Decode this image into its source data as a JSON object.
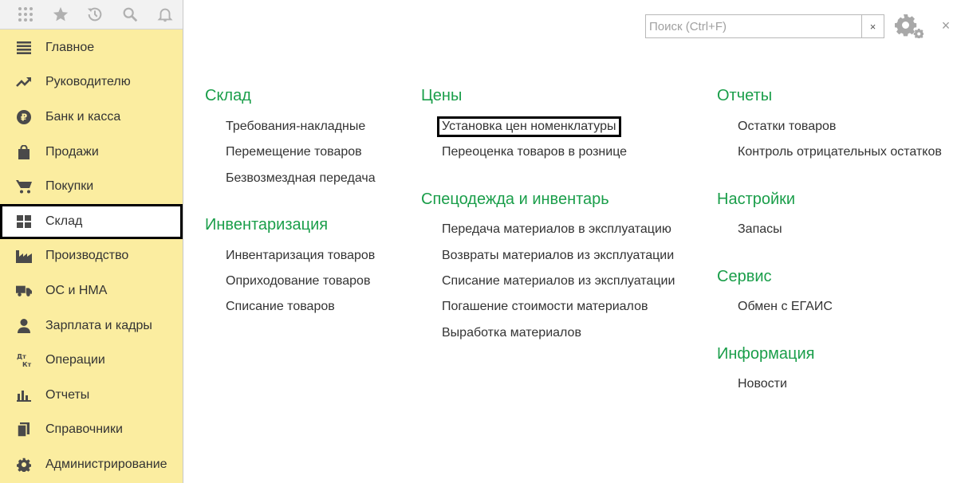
{
  "topbar": {
    "icons": [
      "apps-grid-icon",
      "star-icon",
      "history-icon",
      "search-icon",
      "bell-icon"
    ]
  },
  "sidebar": {
    "items": [
      {
        "label": "Главное",
        "icon": "menu-lines-icon"
      },
      {
        "label": "Руководителю",
        "icon": "trend-up-icon"
      },
      {
        "label": "Банк и касса",
        "icon": "ruble-coin-icon"
      },
      {
        "label": "Продажи",
        "icon": "shopping-bag-icon"
      },
      {
        "label": "Покупки",
        "icon": "cart-icon"
      },
      {
        "label": "Склад",
        "icon": "warehouse-grid-icon",
        "active": true
      },
      {
        "label": "Производство",
        "icon": "factory-icon"
      },
      {
        "label": "ОС и НМА",
        "icon": "truck-icon"
      },
      {
        "label": "Зарплата и кадры",
        "icon": "person-icon"
      },
      {
        "label": "Операции",
        "icon": "debit-credit-icon",
        "icon_text": "Дт Кт"
      },
      {
        "label": "Отчеты",
        "icon": "bar-chart-icon"
      },
      {
        "label": "Справочники",
        "icon": "books-icon"
      },
      {
        "label": "Администрирование",
        "icon": "gear-icon"
      }
    ]
  },
  "search": {
    "placeholder": "Поиск (Ctrl+F)",
    "clear": "×"
  },
  "header": {
    "close": "×"
  },
  "content": {
    "sklad": {
      "title": "Склад",
      "links": [
        "Требования-накладные",
        "Перемещение товаров",
        "Безвозмездная передача"
      ]
    },
    "inventory": {
      "title": "Инвентаризация",
      "links": [
        "Инвентаризация товаров",
        "Оприходование товаров",
        "Списание товаров"
      ]
    },
    "prices": {
      "title": "Цены",
      "links": [
        "Установка цен номенклатуры",
        "Переоценка товаров в рознице"
      ]
    },
    "workwear": {
      "title": "Спецодежда и инвентарь",
      "links": [
        "Передача материалов в эксплуатацию",
        "Возвраты материалов из эксплуатации",
        "Списание материалов из эксплуатации",
        "Погашение стоимости материалов",
        "Выработка материалов"
      ]
    },
    "reports": {
      "title": "Отчеты",
      "links": [
        "Остатки товаров",
        "Контроль отрицательных остатков"
      ]
    },
    "settings": {
      "title": "Настройки",
      "links": [
        "Запасы"
      ]
    },
    "service": {
      "title": "Сервис",
      "links": [
        "Обмен с ЕГАИС"
      ]
    },
    "info": {
      "title": "Информация",
      "links": [
        "Новости"
      ]
    }
  },
  "colors": {
    "sidebar_bg": "#fbeda0",
    "section_title": "#1a9e4a",
    "highlight_border": "#000000"
  }
}
